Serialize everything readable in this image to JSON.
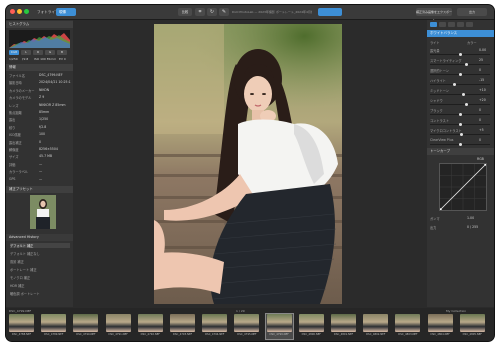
{
  "titlebar": {
    "tab_photo": "フォトライブラリ",
    "tab_develop": "現像",
    "title": "DxO PhotoLab — 2023年撮影 ポートレート_2024年4月撮影 / DSC_4799.NEF",
    "compare_label": "比較",
    "right_button": "補正済み画像をエクスポート",
    "rightmost_button": "出力"
  },
  "left_panel": {
    "histogram_header": "ヒストグラム",
    "histogram_buttons": [
      "RGB",
      "L",
      "R",
      "G",
      "B"
    ],
    "exif_values": [
      "1/250",
      "f/2.8",
      "ISO 100",
      "85mm",
      "EV 0"
    ],
    "info_header": "情報",
    "info_rows": [
      {
        "label": "ファイル名",
        "value": "DSC_4799.NEF"
      },
      {
        "label": "撮影日時",
        "value": "2024/04/21 10:25:17"
      },
      {
        "label": "カメラのメーカー",
        "value": "NIKON"
      },
      {
        "label": "カメラのモデル",
        "value": "Z 9"
      },
      {
        "label": "レンズ",
        "value": "NIKKOR Z 85mm"
      },
      {
        "label": "焦点距離",
        "value": "85mm"
      },
      {
        "label": "露出",
        "value": "1/250"
      },
      {
        "label": "絞り",
        "value": "f/2.8"
      },
      {
        "label": "ISO感度",
        "value": "100"
      },
      {
        "label": "露出補正",
        "value": "0"
      },
      {
        "label": "解像度",
        "value": "8256×5504"
      },
      {
        "label": "サイズ",
        "value": "45.7 MB"
      },
      {
        "label": "評価",
        "value": "—"
      },
      {
        "label": "カラーラベル",
        "value": "—"
      },
      {
        "label": "GPS",
        "value": "—"
      }
    ],
    "preset_header": "補正プリセット",
    "preset_items": [
      "デフォルト 補正",
      "デフォルト 補正なし",
      "風景 補正",
      "ポートレート 補正",
      "モノクロ 補正",
      "HDR 補正",
      "暖色調 ポートレート"
    ],
    "advanced_label": "Advanced History"
  },
  "right_panel": {
    "header": "ホワイトバランス",
    "section1": "ライト",
    "section2": "カラー",
    "section3": "トーンカーブ",
    "sliders": [
      {
        "label": "露光量",
        "value": "0.00",
        "pos": 0.5
      },
      {
        "label": "スマートライティング",
        "value": "25",
        "pos": 0.6
      },
      {
        "label": "選択的トーン",
        "value": "0",
        "pos": 0.5
      },
      {
        "label": "ハイライト",
        "value": "-15",
        "pos": 0.4
      },
      {
        "label": "ミッドトーン",
        "value": "+10",
        "pos": 0.55
      },
      {
        "label": "シャドウ",
        "value": "+20",
        "pos": 0.6
      },
      {
        "label": "ブラック",
        "value": "0",
        "pos": 0.5
      },
      {
        "label": "コントラスト",
        "value": "0",
        "pos": 0.5
      },
      {
        "label": "マイクロコントラスト",
        "value": "+5",
        "pos": 0.52
      },
      {
        "label": "ClearView Plus",
        "value": "0",
        "pos": 0.5
      }
    ],
    "curve_channel": "RGB",
    "bottom_rows": [
      {
        "label": "ガンマ",
        "value": "1.00"
      },
      {
        "label": "出力",
        "value": "0 / 255"
      }
    ]
  },
  "filmstrip": {
    "label": "DSC_4799.NEF",
    "count": "1 / 29",
    "right_label": "My Collection",
    "thumbnails": [
      {
        "label": "DSC_4788.NEF"
      },
      {
        "label": "DSC_4789.NEF"
      },
      {
        "label": "DSC_4790.NEF"
      },
      {
        "label": "DSC_4791.NEF"
      },
      {
        "label": "DSC_4792.NEF"
      },
      {
        "label": "DSC_4793.NEF"
      },
      {
        "label": "DSC_4794.NEF"
      },
      {
        "label": "DSC_4795.NEF"
      },
      {
        "label": "DSC_4799.NEF"
      },
      {
        "label": "DSC_4800.NEF"
      },
      {
        "label": "DSC_4801.NEF"
      },
      {
        "label": "DSC_4802.NEF"
      },
      {
        "label": "DSC_4803.NEF"
      },
      {
        "label": "DSC_4804.NEF"
      },
      {
        "label": "DSC_4805.NEF"
      }
    ]
  },
  "colors": {
    "accent": "#3d8fd6",
    "background": "#2b2b2b",
    "panel": "#323232"
  }
}
